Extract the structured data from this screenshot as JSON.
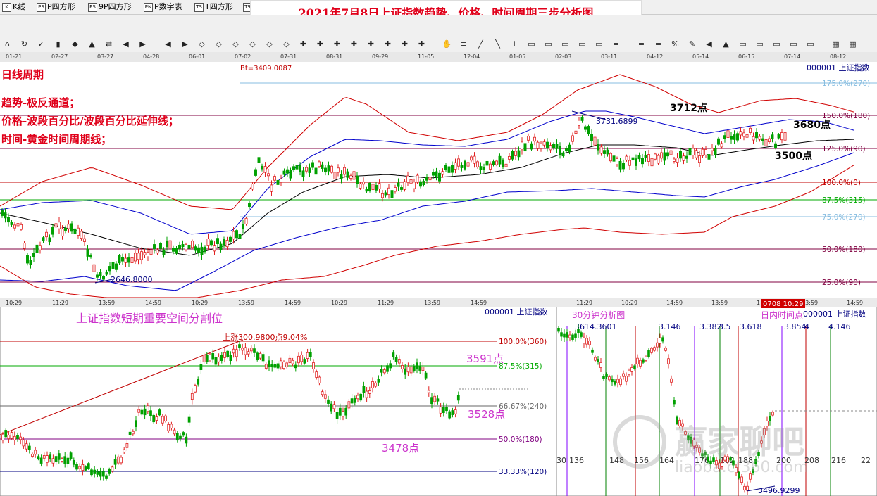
{
  "menu": {
    "items": [
      {
        "icon": "chart-icon",
        "label": "K线"
      },
      {
        "icon": "ps-icon",
        "label": "P四方形"
      },
      {
        "icon": "ps-icon",
        "label": "9P四方形"
      },
      {
        "icon": "pn-icon",
        "label": "P数字表"
      },
      {
        "icon": "ts-icon",
        "label": "T四方形"
      },
      {
        "icon": "ts-icon",
        "label": "T9"
      }
    ]
  },
  "banner": {
    "title": "2021年7月8日上证指数趋势、价格、时间周期三步分析图"
  },
  "datebar": {
    "dates": [
      "01-21",
      "02-27",
      "03-27",
      "04-28",
      "06-01",
      "07-02",
      "07-31",
      "08-31",
      "09-29",
      "11-05",
      "12-04",
      "01-05",
      "02-03",
      "03-11",
      "04-12",
      "05-14",
      "06-15",
      "07-14",
      "08-12"
    ]
  },
  "main": {
    "bt": "Bt=3409.0087",
    "index_label": "000001  上证指数",
    "notes": [
      "日线周期",
      "趋势-极反通道；",
      "价格-波段百分比/波段百分比延伸线；",
      "时间-黄金时间周期线；"
    ],
    "levels": [
      {
        "label": "175.0%(270)",
        "color": "#87bde0"
      },
      {
        "label": "150.0%(180)",
        "color": "#800040"
      },
      {
        "label": "125.0%(90)",
        "color": "#800040"
      },
      {
        "label": "100.0%(0)",
        "color": "#c00000"
      },
      {
        "label": "87.5%(315)",
        "color": "#00aa00"
      },
      {
        "label": "75.0%(270)",
        "color": "#87bde0"
      },
      {
        "label": "50.0%(180)",
        "color": "#800040"
      },
      {
        "label": "25.0%(90)",
        "color": "#800040"
      }
    ],
    "annotations": {
      "high": "3731.6899",
      "low": "2646.8000",
      "p3712": "3712点",
      "p3680": "3680点",
      "p3500": "3500点"
    }
  },
  "bottom_left": {
    "title": "上证指数短期重要空间分割位",
    "index_label": "000001  上证指数",
    "times": [
      "10:29",
      "11:29",
      "13:59",
      "14:59",
      "10:29",
      "13:59",
      "14:59",
      "10:29",
      "11:29",
      "13:59",
      "14:59"
    ],
    "rise_label": "上涨300.9800点9.04%",
    "levels": [
      {
        "label": "100.0%(360)",
        "color": "#c00000"
      },
      {
        "label": "87.5%(315)",
        "color": "#00aa00"
      },
      {
        "label": "66.67%(240)",
        "color": "#666666"
      },
      {
        "label": "50.0%(180)",
        "color": "#800080"
      },
      {
        "label": "33.33%(120)",
        "color": "#000080"
      }
    ],
    "points": {
      "p3591": "3591点",
      "p3528": "3528点",
      "p3478": "3478点"
    }
  },
  "bottom_right": {
    "title": "30分钟分析图",
    "index_label": "000001  上证指数",
    "intraday": "日内时间点",
    "stamp": "0708 10:29",
    "times": [
      "11:29",
      "10:29",
      "14:59",
      "13:59",
      "11:29",
      "13:59",
      "14:59"
    ],
    "top_labels": [
      "3614.3601",
      "3.146",
      "3.382",
      "3.5",
      "3.618",
      "3.854",
      "4",
      "4.146"
    ],
    "bottom_labels": [
      "30",
      "136",
      "148",
      "156",
      "164",
      "176",
      "182",
      "188",
      "200",
      "208",
      "216",
      "22"
    ],
    "low": "3496.9299"
  },
  "watermark": "赢家聊吧",
  "watermark_sub": "liaoba.cf360.com",
  "chart_data": [
    {
      "type": "line",
      "title": "日线周期",
      "x_ticks": [
        "01-21",
        "02-27",
        "03-27",
        "04-28",
        "06-01",
        "07-02",
        "07-31",
        "08-31",
        "09-29",
        "11-05",
        "12-04",
        "01-05",
        "02-03",
        "03-11",
        "04-12",
        "05-14",
        "06-15",
        "07-14",
        "08-12"
      ],
      "series_note": "daily candlestick with extreme channel",
      "annotations": [
        {
          "text": "3731.6899",
          "value": 3731.6899
        },
        {
          "text": "2646.8000",
          "value": 2646.8
        }
      ],
      "levels": [
        "175.0%(270)",
        "150.0%(180)",
        "125.0%(90)",
        "100.0%(0)",
        "87.5%(315)",
        "75.0%(270)",
        "50.0%(180)",
        "25.0%(90)"
      ]
    },
    {
      "type": "line",
      "title": "上证指数短期重要空间分割位",
      "levels": [
        "100.0%(360)",
        "87.5%(315)",
        "66.67%(240)",
        "50.0%(180)",
        "33.33%(120)"
      ],
      "annotations": [
        {
          "text": "上涨300.9800点9.04%"
        },
        {
          "text": "3591点"
        },
        {
          "text": "3528点"
        },
        {
          "text": "3478点"
        }
      ]
    },
    {
      "type": "line",
      "title": "30分钟分析图",
      "annotations": [
        {
          "text": "3614.3601",
          "value": 3614.3601
        },
        {
          "text": "3496.9299",
          "value": 3496.9299
        }
      ]
    }
  ]
}
